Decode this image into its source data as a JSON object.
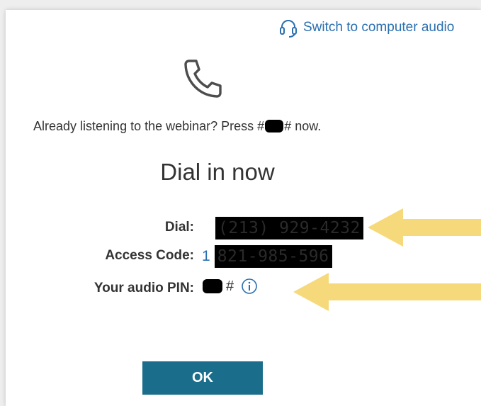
{
  "switch_audio": {
    "label": "Switch to computer audio",
    "icon": "headset-icon"
  },
  "prompt": {
    "before": "Already listening to the webinar? Press #",
    "after": "# now."
  },
  "title": "Dial in now",
  "dial": {
    "label": "Dial:",
    "value": "(213) 929-4232"
  },
  "access_code": {
    "label": "Access Code:",
    "prefix": "1",
    "value": "821-985-596"
  },
  "audio_pin": {
    "label": "Your audio PIN:",
    "suffix": "#",
    "icon": "info-icon"
  },
  "ok_label": "OK",
  "colors": {
    "accent": "#2a6fb0",
    "button": "#1a6e8c",
    "arrow": "#f6d97a",
    "text": "#333333"
  }
}
